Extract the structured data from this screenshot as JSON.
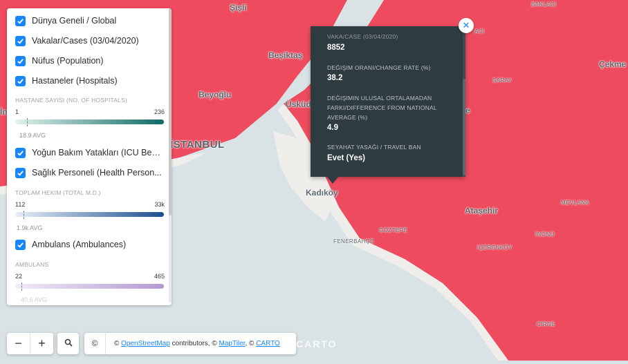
{
  "colors": {
    "region_fill": "#ee4b5e",
    "water": "#d9e3e6",
    "land_grey": "#f0eeea",
    "accent": "#1785fb",
    "popup_bg": "#2e3b40"
  },
  "legend": {
    "layers": [
      {
        "label": "Dünya Geneli / Global",
        "checked": true
      },
      {
        "label": "Vakalar/Cases (03/04/2020)",
        "checked": true
      },
      {
        "label": "Nüfus (Population)",
        "checked": true
      },
      {
        "label": "Hastaneler (Hospitals)",
        "checked": true
      },
      {
        "label": "Yoğun Bakım Yatakları (ICU Beds)",
        "checked": true
      },
      {
        "label": "Sağlık Personeli (Health Person...",
        "checked": true
      },
      {
        "label": "Ambulans (Ambulances)",
        "checked": true
      }
    ],
    "scales": [
      {
        "title": "HASTANE SAYISI (NO. OF HOSPITALS)",
        "min": "1",
        "max": "236",
        "avg": "18.9 AVG",
        "avg_fraction": 0.077,
        "colors": [
          "#e3f1ec",
          "#0f6b66"
        ]
      },
      {
        "title": "TOPLAM HEKIM (TOTAL M.D.)",
        "min": "112",
        "max": "33k",
        "avg": "1.9k AVG",
        "avg_fraction": 0.054,
        "colors": [
          "#e6eef8",
          "#1c4e8e"
        ]
      },
      {
        "title": "AMBULANS",
        "min": "22",
        "max": "465",
        "avg": "40.6 AVG",
        "avg_fraction": 0.042,
        "colors": [
          "#f3eaf7",
          "#b39bd2"
        ]
      }
    ]
  },
  "popup": {
    "fields": [
      {
        "label": "VAKA/CASE (03/04/2020)",
        "value": "8852"
      },
      {
        "label": "DEĞIŞIM ORANI/CHANGE RATE (%)",
        "value": "38.2"
      },
      {
        "label": "DEĞIŞIMIN ULUSAL ORTALAMADAN FARKI/DIFFERENCE FROM NATIONAL AVERAGE (%)",
        "value": "4.9"
      },
      {
        "label": "SEYAHAT YASAĞI / TRAVEL BAN",
        "value": "Evet (Yes)"
      }
    ],
    "close_icon": "close-icon"
  },
  "map": {
    "labels": [
      {
        "text": "Şişli"
      },
      {
        "text": "Beşiktaş"
      },
      {
        "text": "Beyoğlu"
      },
      {
        "text": "Üsküdar"
      },
      {
        "text": "İSTANBUL"
      },
      {
        "text": "Kadıköy"
      },
      {
        "text": "Ataşehir"
      },
      {
        "text": "Çekme"
      },
      {
        "text": "BAKLACI"
      },
      {
        "text": "SARAY"
      },
      {
        "text": "GÖZTEPE"
      },
      {
        "text": "FENERBAHÇE"
      },
      {
        "text": "MEVLANA"
      },
      {
        "text": "İNÖNÜ"
      },
      {
        "text": "İÇERENKÖY"
      },
      {
        "text": "CİRNE"
      },
      {
        "text": "ACI"
      },
      {
        "text": "İn"
      },
      {
        "text": "e"
      }
    ]
  },
  "controls": {
    "zoom_out": "−",
    "zoom_in": "+",
    "search_icon": "search-icon"
  },
  "attribution": {
    "copyright_symbol": "©",
    "prefix": "© ",
    "osm": "OpenStreetMap",
    "mid1": " contributors, © ",
    "maptiler": "MapTiler",
    "mid2": ", © ",
    "carto": "CARTO"
  },
  "carto_logo": "CARTO"
}
